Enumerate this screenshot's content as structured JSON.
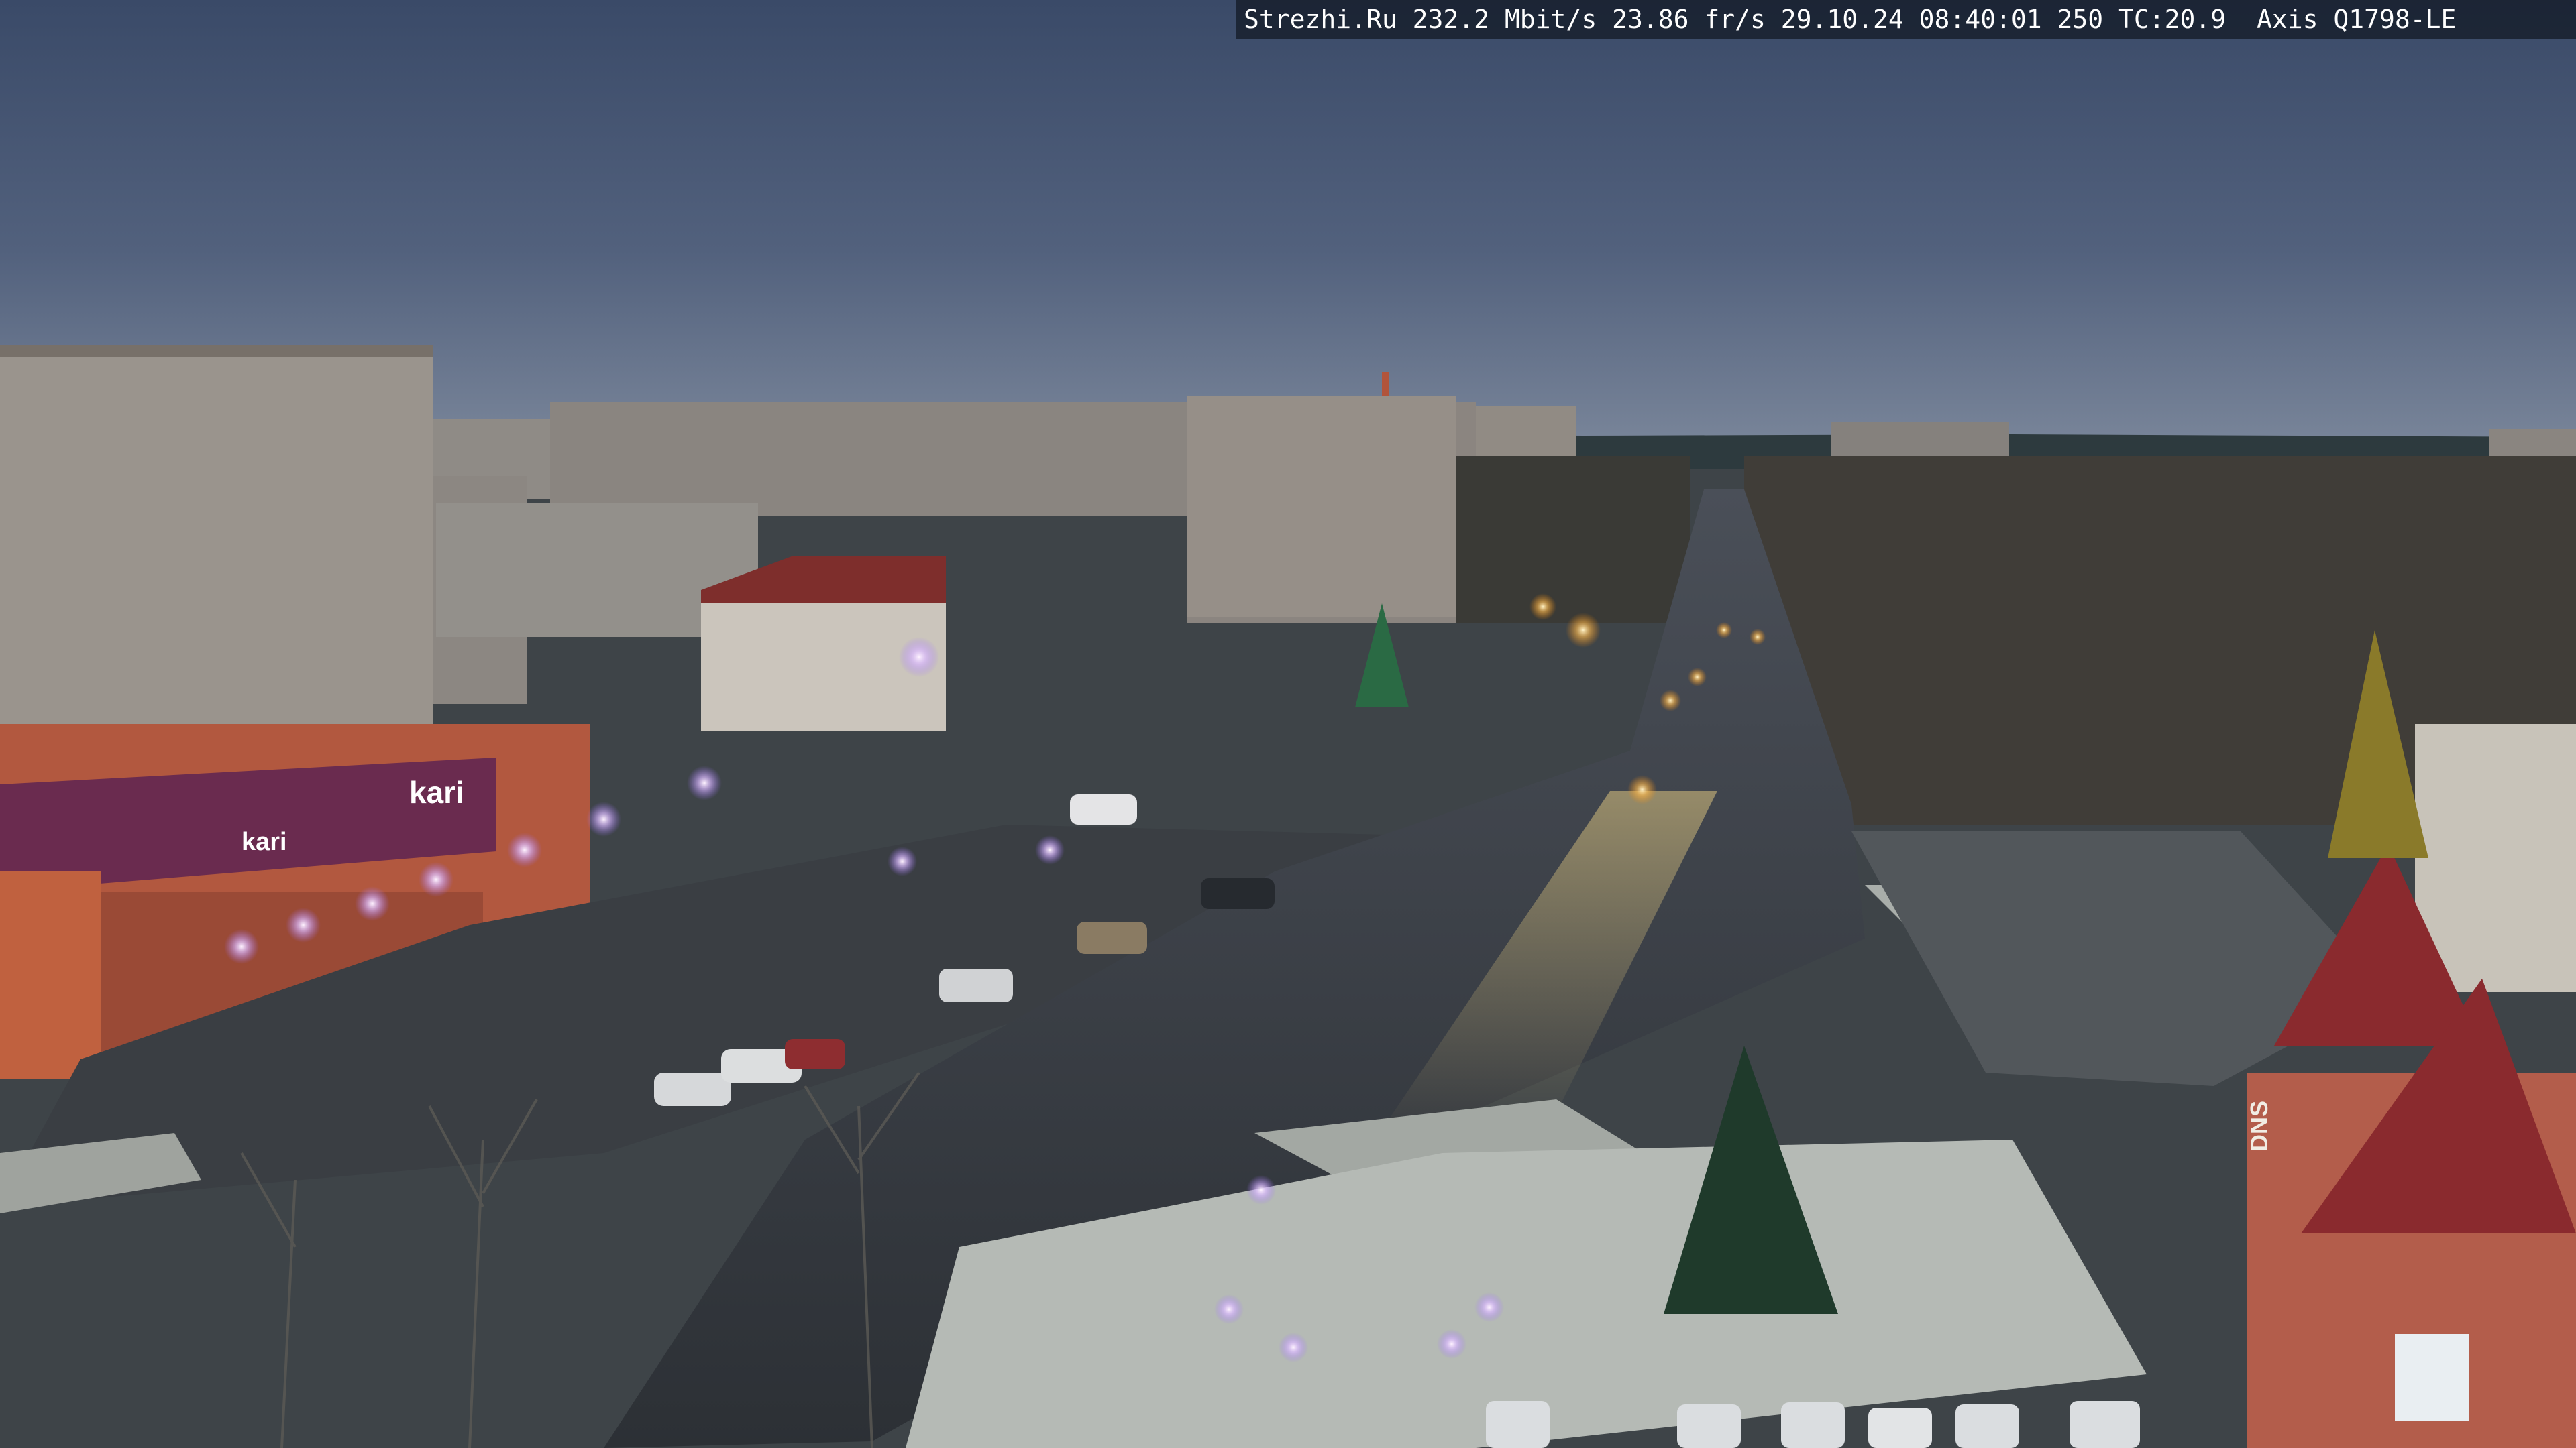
{
  "camera_overlay": {
    "text": "Strezhi.Ru 232.2 Mbit/s 23.86 fr/s 29.10.24 08:40:01 250 TC:20.9  Axis Q1798-LE"
  },
  "signage": {
    "store_left": "kari",
    "store_left_secondary": "kari",
    "building_right": "DNS"
  },
  "scene": {
    "sky_top": "#3d4d6b",
    "sky_horizon": "#6f7e96",
    "road_wet": "#34393f",
    "snow": "#b9beb9",
    "brick": "#a8553e",
    "street_light": "#f1e3ff"
  }
}
